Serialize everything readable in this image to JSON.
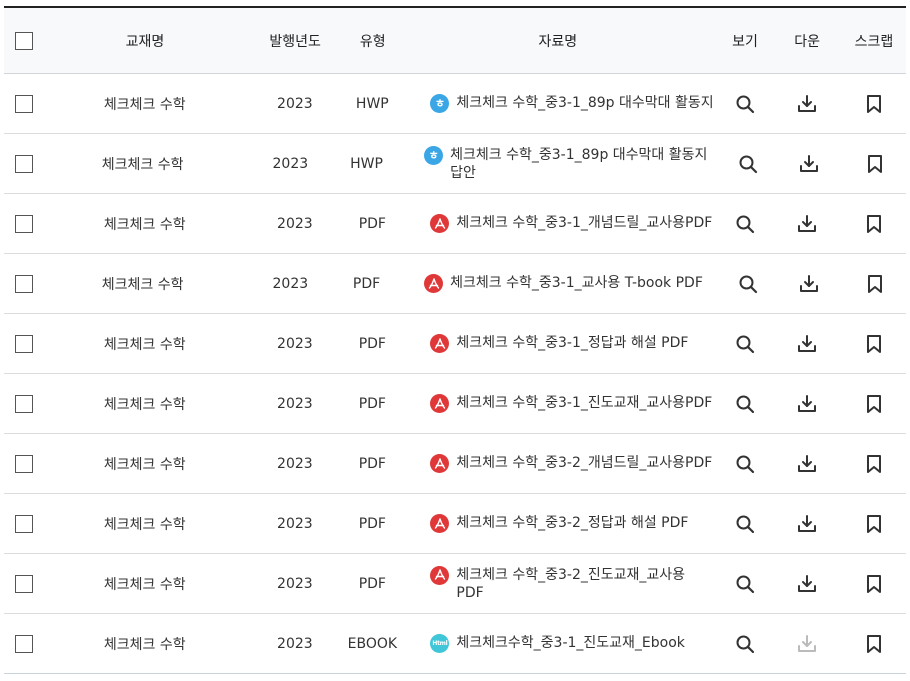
{
  "header": {
    "book": "교재명",
    "year": "발행년도",
    "type": "유형",
    "name": "자료명",
    "view": "보기",
    "down": "다운",
    "scrap": "스크랩"
  },
  "colors": {
    "hwp_icon": "#3aa6e6",
    "pdf_icon": "#e03838",
    "html_icon": "#3fc6d8",
    "icon_stroke": "#333333",
    "icon_disabled": "#bbbbbb"
  },
  "rows": [
    {
      "book": "체크체크 수학",
      "year": "2023",
      "type": "HWP",
      "file_icon": "hwp",
      "icon_glyph": "ㅎ",
      "name": "체크체크 수학_중3-1_89p 대수막대 활동지",
      "download_enabled": true
    },
    {
      "book": "체크체크 수학",
      "year": "2023",
      "type": "HWP",
      "file_icon": "hwp",
      "icon_glyph": "ㅎ",
      "name": "체크체크 수학_중3-1_89p 대수막대 활동지 답안",
      "download_enabled": true
    },
    {
      "book": "체크체크 수학",
      "year": "2023",
      "type": "PDF",
      "file_icon": "pdf",
      "icon_glyph": "",
      "name": "체크체크 수학_중3-1_개념드릴_교사용PDF",
      "download_enabled": true
    },
    {
      "book": "체크체크 수학",
      "year": "2023",
      "type": "PDF",
      "file_icon": "pdf",
      "icon_glyph": "",
      "name": "체크체크 수학_중3-1_교사용 T-book PDF",
      "download_enabled": true
    },
    {
      "book": "체크체크 수학",
      "year": "2023",
      "type": "PDF",
      "file_icon": "pdf",
      "icon_glyph": "",
      "name": "체크체크 수학_중3-1_정답과 해설 PDF",
      "download_enabled": true
    },
    {
      "book": "체크체크 수학",
      "year": "2023",
      "type": "PDF",
      "file_icon": "pdf",
      "icon_glyph": "",
      "name": "체크체크 수학_중3-1_진도교재_교사용PDF",
      "download_enabled": true
    },
    {
      "book": "체크체크 수학",
      "year": "2023",
      "type": "PDF",
      "file_icon": "pdf",
      "icon_glyph": "",
      "name": "체크체크 수학_중3-2_개념드릴_교사용PDF",
      "download_enabled": true
    },
    {
      "book": "체크체크 수학",
      "year": "2023",
      "type": "PDF",
      "file_icon": "pdf",
      "icon_glyph": "",
      "name": "체크체크 수학_중3-2_정답과 해설 PDF",
      "download_enabled": true
    },
    {
      "book": "체크체크 수학",
      "year": "2023",
      "type": "PDF",
      "file_icon": "pdf",
      "icon_glyph": "",
      "name": "체크체크 수학_중3-2_진도교재_교사용 PDF",
      "download_enabled": true
    },
    {
      "book": "체크체크 수학",
      "year": "2023",
      "type": "EBOOK",
      "file_icon": "html",
      "icon_glyph": "Html",
      "name": "체크체크수학_중3-1_진도교재_Ebook",
      "download_enabled": false
    }
  ]
}
